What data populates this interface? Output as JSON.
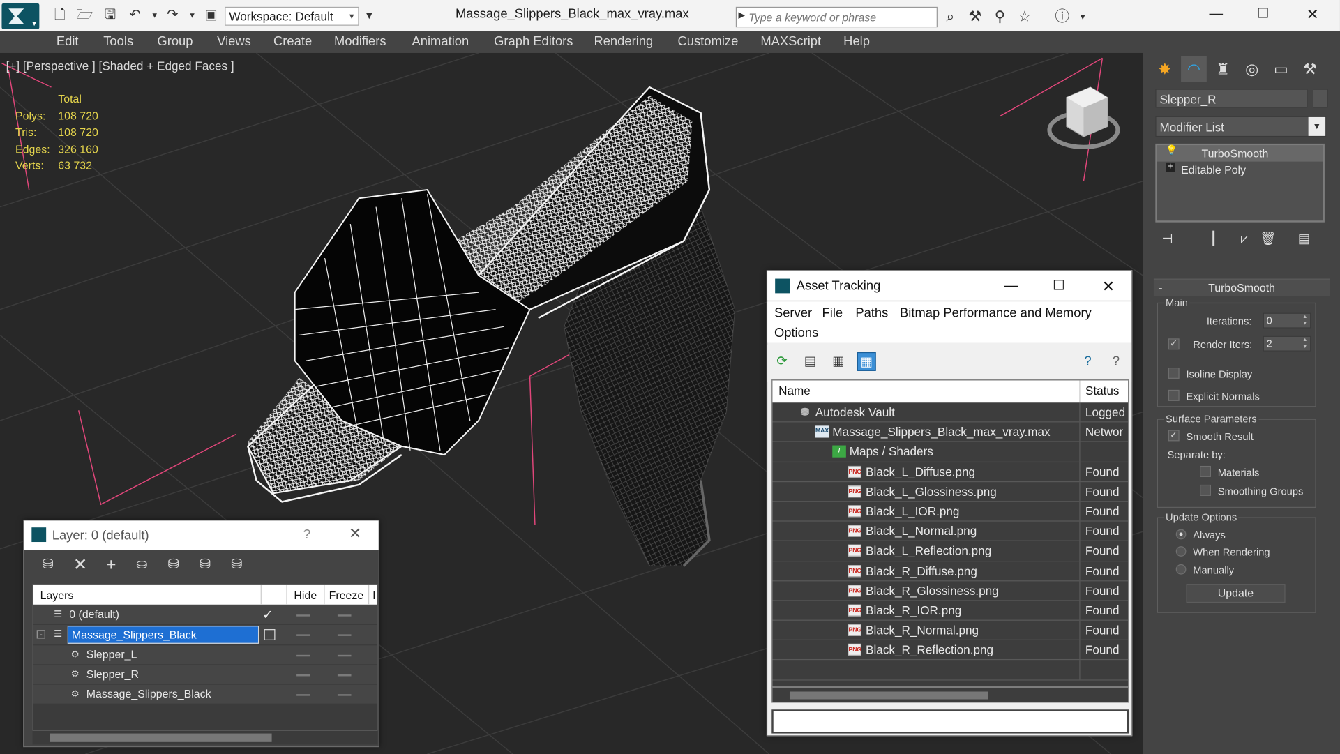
{
  "titlebar": {
    "workspace": "Workspace: Default",
    "file_title": "Massage_Slippers_Black_max_vray.max",
    "search_placeholder": "Type a keyword or phrase"
  },
  "menu": [
    "Edit",
    "Tools",
    "Group",
    "Views",
    "Create",
    "Modifiers",
    "Animation",
    "Graph Editors",
    "Rendering",
    "Customize",
    "MAXScript",
    "Help"
  ],
  "viewport": {
    "label": "[+] [Perspective ] [Shaded + Edged Faces ]",
    "stats": {
      "header": "Total",
      "rows": [
        {
          "k": "Polys:",
          "v": "108 720"
        },
        {
          "k": "Tris:",
          "v": "108 720"
        },
        {
          "k": "Edges:",
          "v": "326 160"
        },
        {
          "k": "Verts:",
          "v": "63 732"
        }
      ]
    }
  },
  "command_panel": {
    "object_name": "Slepper_R",
    "modifier_list": "Modifier List",
    "stack": [
      "TurboSmooth",
      "Editable Poly"
    ],
    "rollout_title": "TurboSmooth",
    "main_label": "Main",
    "iterations_label": "Iterations:",
    "iterations_value": "0",
    "render_iters_label": "Render Iters:",
    "render_iters_value": "2",
    "isoline_label": "Isoline Display",
    "explicit_normals_label": "Explicit Normals",
    "surface_params_label": "Surface Parameters",
    "smooth_result_label": "Smooth Result",
    "separate_by_label": "Separate by:",
    "materials_label": "Materials",
    "smoothing_groups_label": "Smoothing Groups",
    "update_options_label": "Update Options",
    "always_label": "Always",
    "when_rendering_label": "When Rendering",
    "manually_label": "Manually",
    "update_button": "Update"
  },
  "asset_tracking": {
    "title": "Asset Tracking",
    "menu": [
      "Server",
      "File",
      "Paths",
      "Bitmap Performance and Memory",
      "Options"
    ],
    "col_name": "Name",
    "col_status": "Status",
    "rows": [
      {
        "name": "Autodesk Vault",
        "status": "Logged",
        "icon": "vault-icon",
        "indent": 0
      },
      {
        "name": "Massage_Slippers_Black_max_vray.max",
        "status": "Networ",
        "icon": "max-file-icon",
        "indent": 1
      },
      {
        "name": "Maps / Shaders",
        "status": "",
        "icon": "maps-icon",
        "indent": 2
      },
      {
        "name": "Black_L_Diffuse.png",
        "status": "Found",
        "icon": "png-icon",
        "indent": 3
      },
      {
        "name": "Black_L_Glossiness.png",
        "status": "Found",
        "icon": "png-icon",
        "indent": 3
      },
      {
        "name": "Black_L_IOR.png",
        "status": "Found",
        "icon": "png-icon",
        "indent": 3
      },
      {
        "name": "Black_L_Normal.png",
        "status": "Found",
        "icon": "png-icon",
        "indent": 3
      },
      {
        "name": "Black_L_Reflection.png",
        "status": "Found",
        "icon": "png-icon",
        "indent": 3
      },
      {
        "name": "Black_R_Diffuse.png",
        "status": "Found",
        "icon": "png-icon",
        "indent": 3
      },
      {
        "name": "Black_R_Glossiness.png",
        "status": "Found",
        "icon": "png-icon",
        "indent": 3
      },
      {
        "name": "Black_R_IOR.png",
        "status": "Found",
        "icon": "png-icon",
        "indent": 3
      },
      {
        "name": "Black_R_Normal.png",
        "status": "Found",
        "icon": "png-icon",
        "indent": 3
      },
      {
        "name": "Black_R_Reflection.png",
        "status": "Found",
        "icon": "png-icon",
        "indent": 3
      }
    ],
    "png_badge": "PNG"
  },
  "layer_dialog": {
    "title": "Layer: 0 (default)",
    "help": "?",
    "col_layers": "Layers",
    "col_hide": "Hide",
    "col_freeze": "Freeze",
    "col_extra": "I",
    "rows": [
      {
        "name": "0 (default)",
        "level": 0,
        "current": true,
        "selected": false
      },
      {
        "name": "Massage_Slippers_Black",
        "level": 0,
        "current": false,
        "selected": true
      },
      {
        "name": "Slepper_L",
        "level": 1,
        "current": false,
        "selected": false
      },
      {
        "name": "Slepper_R",
        "level": 1,
        "current": false,
        "selected": false
      },
      {
        "name": "Massage_Slippers_Black",
        "level": 1,
        "current": false,
        "selected": false
      }
    ]
  },
  "colors": {
    "accent": "#2ea6e8",
    "stats_text": "#e4d44c",
    "selection_blue": "#1e6fd3",
    "grid_lines": "#3c3c3c",
    "bbox_pink": "#e0467a"
  }
}
